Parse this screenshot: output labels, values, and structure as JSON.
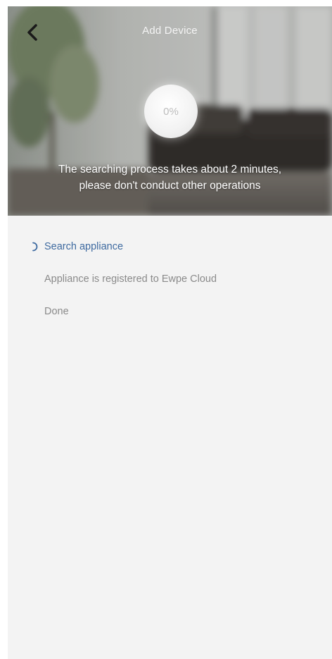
{
  "header": {
    "title": "Add Device",
    "back_icon": "chevron-left-icon"
  },
  "progress": {
    "label": "0%",
    "value": 0
  },
  "hint": {
    "line1": "The searching process takes about 2 minutes,",
    "line2": "please don't conduct other operations"
  },
  "steps": [
    {
      "label": "Search appliance",
      "state": "active",
      "icon": "loading-spinner-icon"
    },
    {
      "label": "Appliance is registered to Ewpe Cloud",
      "state": "pending"
    },
    {
      "label": "Done",
      "state": "pending"
    }
  ],
  "colors": {
    "active_step": "#3e6aa0",
    "pending_step": "#8a8a8a",
    "background": "#f3f3f3"
  }
}
